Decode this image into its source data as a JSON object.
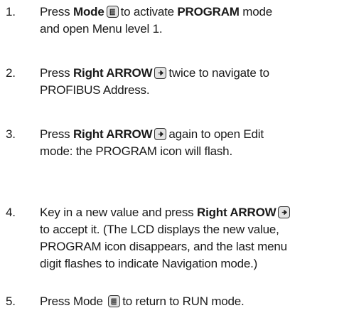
{
  "steps": [
    {
      "num": "1.",
      "lines": [
        [
          {
            "t": "Press "
          },
          {
            "t": "Mode",
            "b": true
          },
          {
            "key": "mode-key-icon"
          },
          {
            "t": "to activate "
          },
          {
            "t": "PROGRAM",
            "b": true
          },
          {
            "t": " mode"
          }
        ],
        [
          {
            "t": "and open Menu level 1."
          }
        ]
      ]
    },
    {
      "num": "2.",
      "lines": [
        [
          {
            "t": "Press "
          },
          {
            "t": "Right ARROW",
            "b": true
          },
          {
            "key": "right-arrow-key-icon"
          },
          {
            "t": "twice to navigate to"
          }
        ],
        [
          {
            "t": "PROFIBUS Address."
          }
        ]
      ]
    },
    {
      "num": "3.",
      "lines": [
        [
          {
            "t": "Press "
          },
          {
            "t": "Right ARROW",
            "b": true
          },
          {
            "key": "right-arrow-key-icon"
          },
          {
            "t": "again to open Edit"
          }
        ],
        [
          {
            "t": "mode: the PROGRAM icon will flash."
          }
        ]
      ]
    },
    {
      "num": "4.",
      "lines": [
        [
          {
            "t": "Key in a new value and press "
          },
          {
            "t": "Right ARROW",
            "b": true
          },
          {
            "key": "right-arrow-key-icon"
          }
        ],
        [
          {
            "t": "to accept it. (The LCD displays the new value,"
          }
        ],
        [
          {
            "t": "PROGRAM icon disappears, and the last menu"
          }
        ],
        [
          {
            "t": "digit flashes to indicate Navigation mode.)"
          }
        ]
      ]
    },
    {
      "num": "5.",
      "lines": [
        [
          {
            "t": "Press Mode "
          },
          {
            "key": "mode-key-icon"
          },
          {
            "t": "to return to RUN mode."
          }
        ]
      ]
    }
  ]
}
